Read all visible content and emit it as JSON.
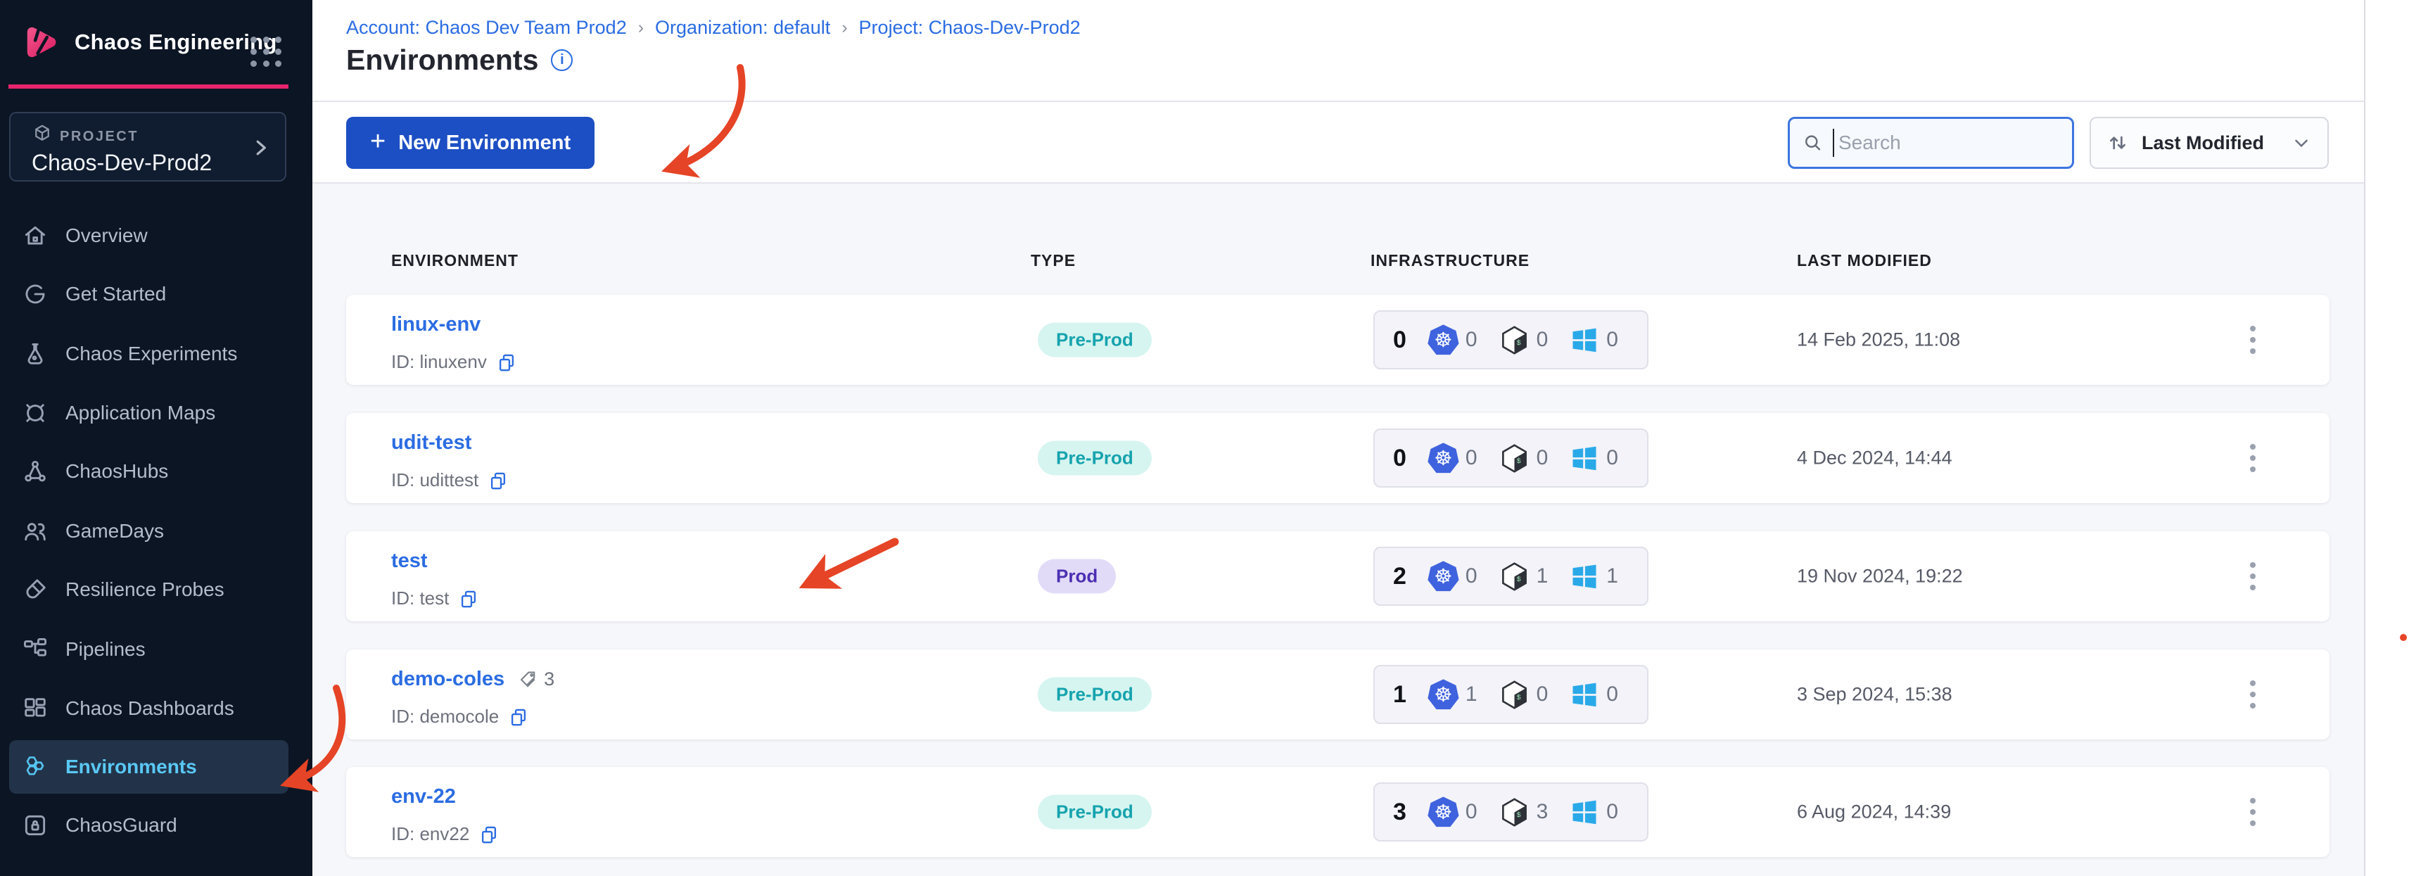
{
  "app": {
    "name": "Chaos Engineering"
  },
  "project": {
    "eyebrow": "PROJECT",
    "name": "Chaos-Dev-Prod2"
  },
  "sidebar": {
    "items": [
      {
        "label": "Overview",
        "active": false
      },
      {
        "label": "Get Started",
        "active": false
      },
      {
        "label": "Chaos Experiments",
        "active": false
      },
      {
        "label": "Application Maps",
        "active": false
      },
      {
        "label": "ChaosHubs",
        "active": false
      },
      {
        "label": "GameDays",
        "active": false
      },
      {
        "label": "Resilience Probes",
        "active": false
      },
      {
        "label": "Pipelines",
        "active": false
      },
      {
        "label": "Chaos Dashboards",
        "active": false
      },
      {
        "label": "Environments",
        "active": true
      },
      {
        "label": "ChaosGuard",
        "active": false
      }
    ]
  },
  "breadcrumb": {
    "separator": "›",
    "items": [
      "Account: Chaos Dev Team Prod2",
      "Organization: default",
      "Project: Chaos-Dev-Prod2"
    ]
  },
  "page": {
    "title": "Environments",
    "info_glyph": "i"
  },
  "toolbar": {
    "new_plus": "+",
    "new_button": "New Environment",
    "search_placeholder": "Search",
    "sort_label": "Last Modified"
  },
  "icons": {
    "k8s_glyph": "☸"
  },
  "table": {
    "headers": [
      "ENVIRONMENT",
      "TYPE",
      "INFRASTRUCTURE",
      "LAST MODIFIED"
    ],
    "rows": [
      {
        "name": "linux-env",
        "id_label": "ID: linuxenv",
        "type": "Pre-Prod",
        "total": "0",
        "k8s": "0",
        "linux": "0",
        "windows": "0",
        "modified": "14 Feb 2025, 11:08"
      },
      {
        "name": "udit-test",
        "id_label": "ID: udittest",
        "type": "Pre-Prod",
        "total": "0",
        "k8s": "0",
        "linux": "0",
        "windows": "0",
        "modified": "4 Dec 2024, 14:44"
      },
      {
        "name": "test",
        "id_label": "ID: test",
        "type": "Prod",
        "total": "2",
        "k8s": "0",
        "linux": "1",
        "windows": "1",
        "modified": "19 Nov 2024, 19:22"
      },
      {
        "name": "demo-coles",
        "id_label": "ID: democole",
        "type": "Pre-Prod",
        "total": "1",
        "k8s": "1",
        "linux": "0",
        "windows": "0",
        "modified": "3 Sep 2024, 15:38",
        "tags": "3"
      },
      {
        "name": "env-22",
        "id_label": "ID: env22",
        "type": "Pre-Prod",
        "total": "3",
        "k8s": "0",
        "linux": "3",
        "windows": "0",
        "modified": "6 Aug 2024, 14:39"
      }
    ]
  },
  "colors": {
    "sidebar_bg": "#0c1524",
    "brand_pink": "#e7246d",
    "active_cyan": "#5ac8f5",
    "primary_blue": "#1d4fc4",
    "link_blue": "#2b6ce2",
    "preprod_bg": "#d6f5f0",
    "preprod_text": "#16a3ae",
    "prod_bg": "#e2dbf8",
    "prod_text": "#4c2fb3",
    "k8s_blue": "#3f62de",
    "windows_blue": "#2aa9e9",
    "arrow_red": "#e64426"
  }
}
